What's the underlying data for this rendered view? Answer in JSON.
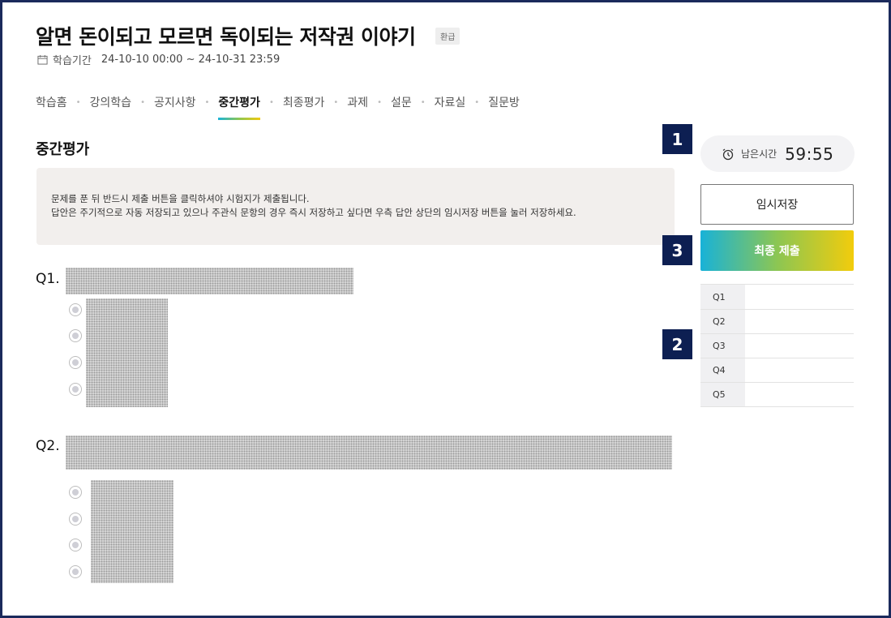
{
  "course": {
    "title": "알면 돈이되고 모르면 독이되는 저작권 이야기",
    "badge": "환급",
    "period_label": "학습기간",
    "period_value": "24-10-10 00:00 ~ 24-10-31 23:59"
  },
  "tabs": [
    {
      "label": "학습홈",
      "active": false
    },
    {
      "label": "강의학습",
      "active": false
    },
    {
      "label": "공지사항",
      "active": false
    },
    {
      "label": "중간평가",
      "active": true
    },
    {
      "label": "최종평가",
      "active": false
    },
    {
      "label": "과제",
      "active": false
    },
    {
      "label": "설문",
      "active": false
    },
    {
      "label": "자료실",
      "active": false
    },
    {
      "label": "질문방",
      "active": false
    }
  ],
  "exam": {
    "title": "중간평가",
    "notice_lines": [
      "문제를 푼 뒤 반드시 제출 버튼을 클릭하셔야 시험지가 제출됩니다.",
      "답안은 주기적으로 자동 저장되고 있으나 주관식 문항의 경우 즉시 저장하고 싶다면 우측 답안 상단의 임시저장 버튼을 눌러 저장하세요."
    ],
    "questions": [
      {
        "label": "Q1.",
        "option_count": 4
      },
      {
        "label": "Q2.",
        "option_count": 4
      }
    ]
  },
  "sidebar": {
    "timer_label": "남은시간",
    "timer_value": "59:55",
    "temp_save_label": "임시저장",
    "submit_label": "최종 제출",
    "answer_rows": [
      "Q1",
      "Q2",
      "Q3",
      "Q4",
      "Q5"
    ]
  },
  "markers": [
    "1",
    "2",
    "3"
  ],
  "colors": {
    "frame": "#1b2a5c",
    "marker": "#0d1f52",
    "gradient_start": "#18b2d8",
    "gradient_mid": "#8cc653",
    "gradient_end": "#f2cc0c",
    "notice_bg": "#f2efed"
  }
}
